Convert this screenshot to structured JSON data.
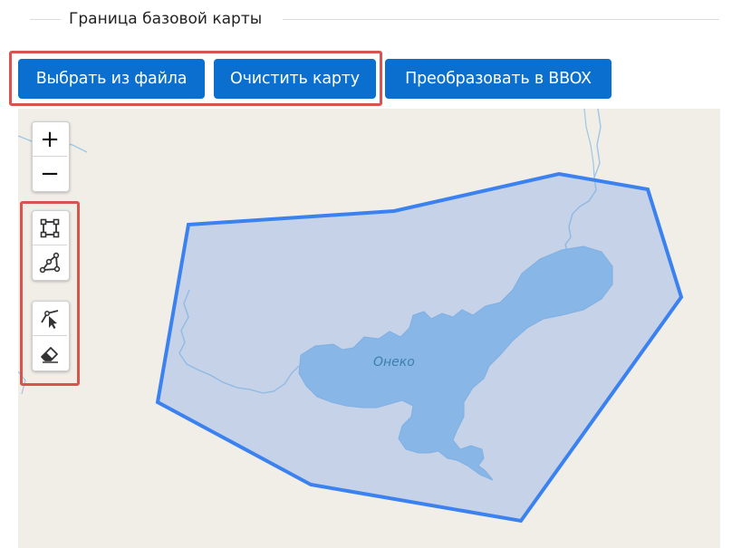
{
  "section": {
    "title": "Граница базовой карты"
  },
  "buttons": {
    "choose_file": "Выбрать из файла",
    "clear_map": "Очистить карту",
    "convert_bbox": "Преобразовать в BBOX"
  },
  "map": {
    "lake_label": "Онеко",
    "zoom_in": "+",
    "zoom_out": "−",
    "draw_tools": [
      "rectangle-tool",
      "polyline-tool",
      "edit-tool",
      "eraser-tool"
    ]
  },
  "colors": {
    "button_bg": "#0a6fce",
    "highlight": "#d9534f",
    "polygon_stroke": "#3b82f0",
    "polygon_fill": "#b8cff0",
    "water": "#92c2e8",
    "map_bg": "#f1eee8"
  }
}
